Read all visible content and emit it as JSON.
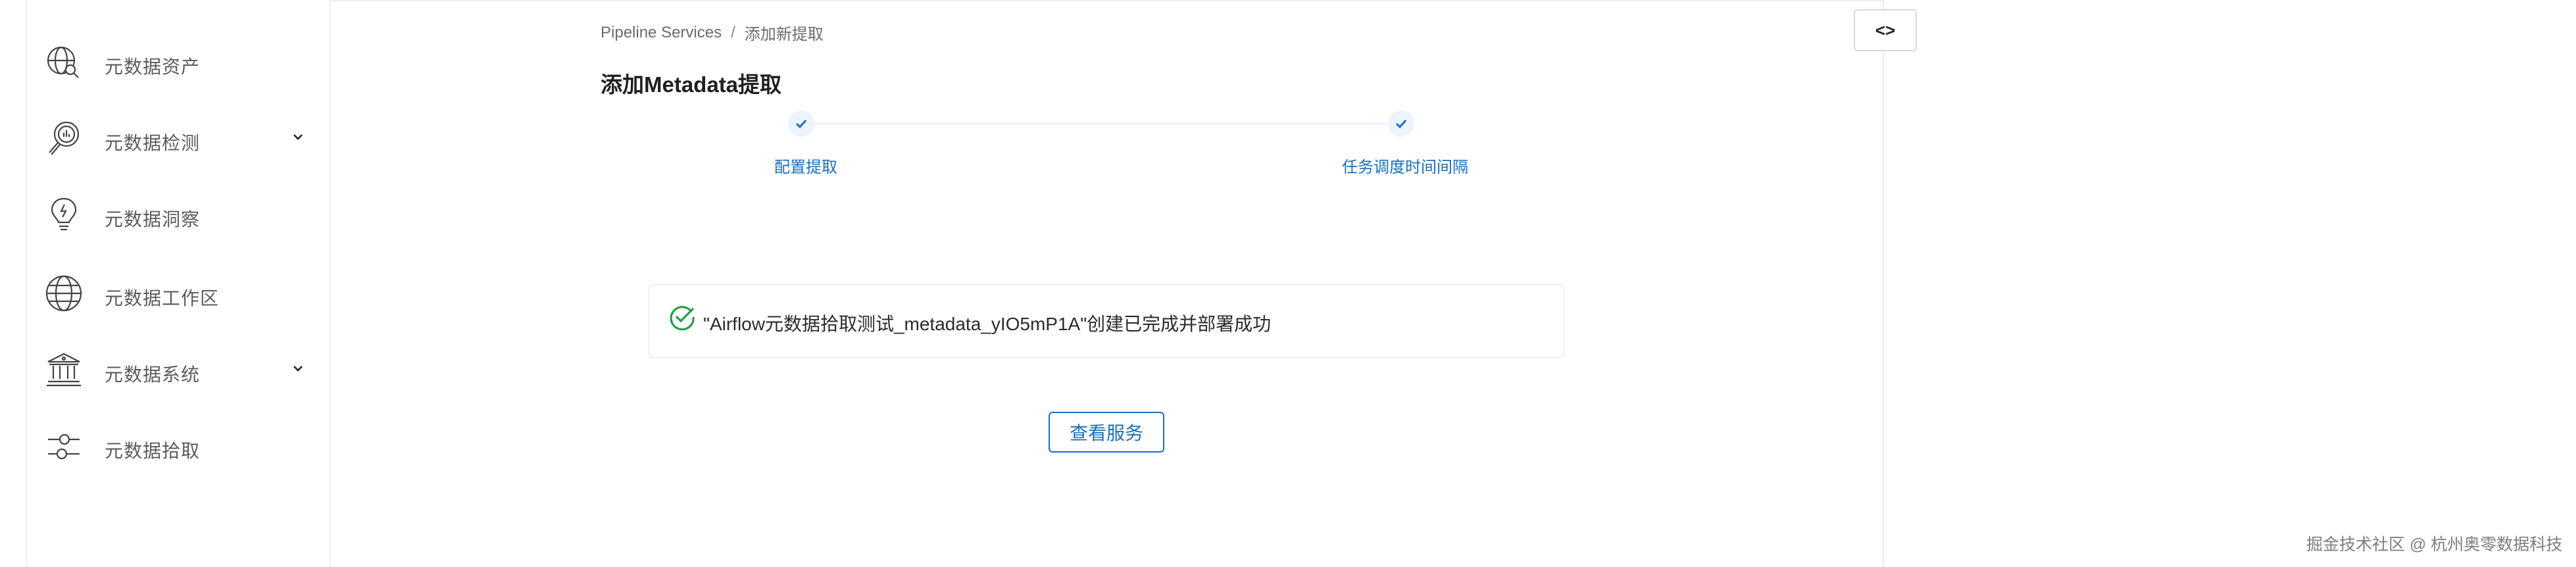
{
  "sidebar": {
    "items": [
      {
        "label": "元数据资产",
        "icon": "globe-search-icon",
        "expandable": false
      },
      {
        "label": "元数据检测",
        "icon": "magnifier-chart-icon",
        "expandable": true
      },
      {
        "label": "元数据洞察",
        "icon": "lightbulb-icon",
        "expandable": false
      },
      {
        "label": "元数据工作区",
        "icon": "globe-icon",
        "expandable": false
      },
      {
        "label": "元数据系统",
        "icon": "bank-building-icon",
        "expandable": true
      },
      {
        "label": "元数据拾取",
        "icon": "sliders-icon",
        "expandable": false
      }
    ]
  },
  "breadcrumb": {
    "root": "Pipeline Services",
    "separator": "/",
    "current": "添加新提取"
  },
  "page": {
    "title": "添加Metadata提取"
  },
  "stepper": {
    "steps": [
      {
        "label": "配置提取",
        "done": true
      },
      {
        "label": "任务调度时间间隔",
        "done": true
      }
    ]
  },
  "success": {
    "message": "\"Airflow元数据拾取测试_metadata_yIO5mP1A\"创建已完成并部署成功"
  },
  "actions": {
    "view_service": "查看服务",
    "code_toggle": "<>"
  },
  "watermark": "掘金技术社区 @ 杭州奥零数据科技",
  "colors": {
    "accent": "#1a6fb9",
    "success": "#1f9e45",
    "sidebar_text": "#5b5b5b"
  }
}
